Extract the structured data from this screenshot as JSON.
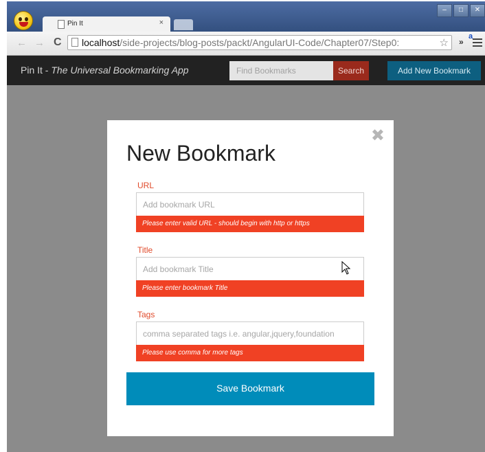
{
  "browser": {
    "tab_title": "Pin It",
    "tab_close": "×",
    "url_host": "localhost",
    "url_path": "/side-projects/blog-posts/packt/AngularUI-Code/Chapter07/Step0:",
    "ext_badge": "a"
  },
  "app": {
    "brand_name": "Pin It - ",
    "brand_tagline": "The Universal Bookmarking App",
    "search_placeholder": "Find Bookmarks",
    "search_button": "Search",
    "add_button": "Add New Bookmark"
  },
  "modal": {
    "close": "✖",
    "title": "New Bookmark",
    "fields": [
      {
        "label": "URL",
        "placeholder": "Add bookmark URL",
        "error": "Please enter valid URL - should begin with http or https"
      },
      {
        "label": "Title",
        "placeholder": "Add bookmark Title",
        "error": "Please enter bookmark Title"
      },
      {
        "label": "Tags",
        "placeholder": "comma separated tags i.e. angular,jquery,foundation",
        "error": "Please use comma for more tags"
      }
    ],
    "save_button": "Save Bookmark"
  },
  "colors": {
    "error_red": "#f04124",
    "primary_blue": "#008cba",
    "navbar": "#222222",
    "backdrop": "#8b8b8b"
  }
}
